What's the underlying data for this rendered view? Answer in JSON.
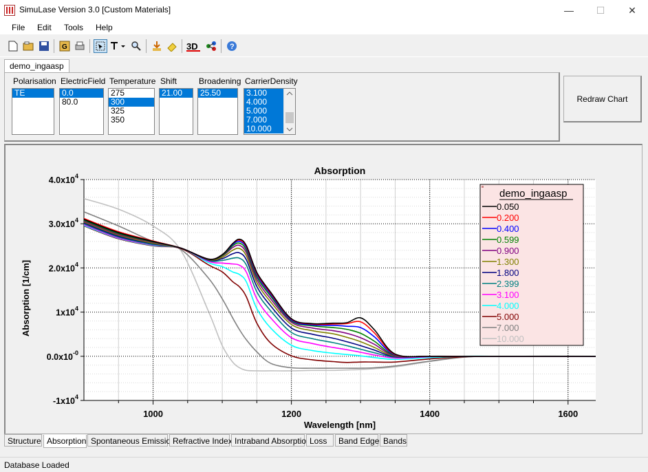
{
  "window": {
    "title": "SimuLase Version 3.0 [Custom Materials]",
    "minimize": "—",
    "maximize": "☐",
    "close": "✕"
  },
  "menu": [
    "File",
    "Edit",
    "Tools",
    "Help"
  ],
  "doc_tab": "demo_ingaasp",
  "params": {
    "polarisation": {
      "label": "Polarisation",
      "items": [
        "TE"
      ],
      "selected": [
        0
      ]
    },
    "electric_field": {
      "label": "ElectricField",
      "items": [
        "0.0",
        "80.0"
      ],
      "selected": [
        0
      ]
    },
    "temperature": {
      "label": "Temperature",
      "items": [
        "275",
        "300",
        "325",
        "350"
      ],
      "selected": [
        1
      ]
    },
    "shift": {
      "label": "Shift",
      "items": [
        "21.00"
      ],
      "selected": [
        0
      ]
    },
    "broadening": {
      "label": "Broadening",
      "items": [
        "25.50"
      ],
      "selected": [
        0
      ]
    },
    "carrier_density": {
      "label": "CarrierDensity",
      "items": [
        "3.100",
        "4.000",
        "5.000",
        "7.000",
        "10.000"
      ],
      "selected": [
        0,
        1,
        2,
        3,
        4
      ]
    }
  },
  "redraw_label": "Redraw Chart",
  "chart_data": {
    "type": "line",
    "title": "Absorption",
    "xlabel": "Wavelength [nm]",
    "ylabel": "Absorption [1/cm]",
    "xlim": [
      900,
      1640
    ],
    "ylim": [
      -10000,
      40000
    ],
    "xticks": [
      1000,
      1200,
      1400,
      1600
    ],
    "yticks": [
      {
        "value": 40000,
        "base": "4.0x10",
        "exp": "4"
      },
      {
        "value": 30000,
        "base": "3.0x10",
        "exp": "4"
      },
      {
        "value": 20000,
        "base": "2.0x10",
        "exp": "4"
      },
      {
        "value": 10000,
        "base": "1x10",
        "exp": "4"
      },
      {
        "value": 0,
        "base": "0.0x10",
        "exp": "-0"
      },
      {
        "value": -10000,
        "base": "-1x10",
        "exp": "4"
      }
    ],
    "grid": true,
    "legend": {
      "title": "demo_ingaasp",
      "placement": "top-right"
    },
    "x": [
      900,
      950,
      1000,
      1040,
      1080,
      1100,
      1115,
      1125,
      1135,
      1150,
      1170,
      1200,
      1230,
      1260,
      1280,
      1300,
      1320,
      1350,
      1400,
      1450,
      1500,
      1640
    ],
    "series": [
      {
        "name": "0.050",
        "color": "#000000",
        "values": [
          31000,
          28000,
          26000,
          24500,
          22000,
          23000,
          25500,
          26500,
          25000,
          19000,
          14500,
          8500,
          7400,
          7500,
          7600,
          8700,
          6000,
          500,
          0,
          0,
          0,
          0
        ]
      },
      {
        "name": "0.200",
        "color": "#ff0000",
        "values": [
          31200,
          28200,
          26100,
          24500,
          22000,
          23000,
          25500,
          26300,
          24800,
          18800,
          14300,
          8400,
          7300,
          7300,
          7400,
          7800,
          5300,
          400,
          0,
          0,
          0,
          0
        ]
      },
      {
        "name": "0.400",
        "color": "#0000ff",
        "values": [
          31000,
          28000,
          26000,
          24500,
          22000,
          23000,
          25300,
          26000,
          24500,
          18500,
          14000,
          8200,
          7100,
          7000,
          6800,
          6500,
          4400,
          300,
          0,
          0,
          0,
          0
        ]
      },
      {
        "name": "0.599",
        "color": "#008000",
        "values": [
          30800,
          27800,
          25900,
          24500,
          22000,
          22800,
          25000,
          25600,
          24000,
          18000,
          13600,
          8000,
          6900,
          6500,
          6100,
          5200,
          3400,
          200,
          0,
          0,
          0,
          0
        ]
      },
      {
        "name": "0.900",
        "color": "#800080",
        "values": [
          30600,
          27600,
          25800,
          24500,
          22000,
          22700,
          24600,
          25100,
          23400,
          17400,
          13000,
          7700,
          6400,
          5800,
          5200,
          4200,
          2700,
          100,
          0,
          0,
          0,
          0
        ]
      },
      {
        "name": "1.300",
        "color": "#808000",
        "values": [
          30400,
          27400,
          25600,
          24500,
          21900,
          22400,
          24000,
          24400,
          22700,
          16700,
          12300,
          7200,
          5800,
          5100,
          4300,
          3300,
          2000,
          0,
          0,
          0,
          0,
          0
        ]
      },
      {
        "name": "1.800",
        "color": "#000080",
        "values": [
          30200,
          27200,
          25500,
          24500,
          21800,
          22100,
          23200,
          23400,
          21800,
          15800,
          11400,
          6400,
          5000,
          4100,
          3300,
          2400,
          1400,
          -100,
          0,
          0,
          0,
          0
        ]
      },
      {
        "name": "2.399",
        "color": "#008080",
        "values": [
          30000,
          27000,
          25300,
          24500,
          21700,
          21700,
          22200,
          22200,
          20600,
          14600,
          10300,
          5400,
          4000,
          3100,
          2400,
          1600,
          800,
          -200,
          0,
          0,
          0,
          0
        ]
      },
      {
        "name": "3.100",
        "color": "#ff00ff",
        "values": [
          29800,
          26800,
          25200,
          24500,
          21500,
          21100,
          20900,
          20600,
          19000,
          13000,
          8700,
          4200,
          2900,
          2000,
          1500,
          900,
          300,
          -400,
          -100,
          0,
          0,
          0
        ]
      },
      {
        "name": "4.000",
        "color": "#00ffff",
        "values": [
          29600,
          26700,
          25100,
          24500,
          21200,
          20300,
          19100,
          18500,
          16800,
          10800,
          6400,
          2500,
          1300,
          700,
          400,
          100,
          -300,
          -700,
          -300,
          0,
          0,
          0
        ]
      },
      {
        "name": "5.000",
        "color": "#800000",
        "values": [
          29500,
          26600,
          25000,
          24400,
          20700,
          19100,
          16900,
          15700,
          13400,
          7500,
          3000,
          100,
          -800,
          -1200,
          -1400,
          -1300,
          -1300,
          -1300,
          -600,
          -100,
          0,
          0
        ]
      },
      {
        "name": "7.000",
        "color": "#808080",
        "values": [
          32700,
          29500,
          26000,
          24200,
          17700,
          13000,
          8700,
          6000,
          3700,
          1000,
          -1600,
          -2600,
          -2700,
          -2700,
          -2700,
          -2700,
          -2600,
          -2200,
          -1100,
          -200,
          0,
          0
        ]
      },
      {
        "name": "10.000",
        "color": "#c0c0c0",
        "values": [
          35700,
          33300,
          29500,
          24000,
          10200,
          2400,
          -1300,
          -2600,
          -3200,
          -3300,
          -3300,
          -3300,
          -3200,
          -3200,
          -3100,
          -3000,
          -2800,
          -2400,
          -1200,
          -200,
          0,
          0
        ]
      }
    ]
  },
  "bottom_tabs": [
    "Structure",
    "Absorption",
    "Spontaneous Emission",
    "Refractive Index",
    "Intraband Absorption",
    "Loss",
    "Band Edge",
    "Bands"
  ],
  "active_tab": 1,
  "status": "Database Loaded",
  "icons": [
    "new-file-icon",
    "open-icon",
    "save-icon",
    "export-icon",
    "print-icon",
    "select-icon",
    "text-tool-icon",
    "zoom-icon",
    "export-data-icon",
    "eraser-icon",
    "3d-icon",
    "compare-icon",
    "help-icon"
  ]
}
